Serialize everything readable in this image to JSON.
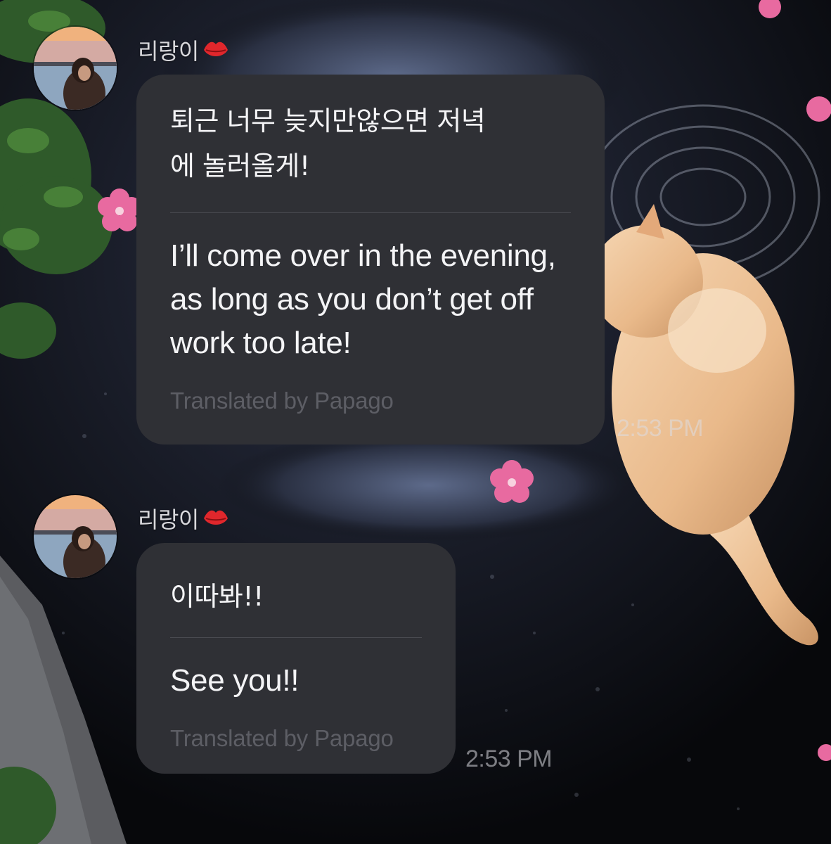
{
  "messages": [
    {
      "sender": "리랑이",
      "sender_icon": "kiss-lips-icon",
      "original": "퇴근 너무 늦지만않으면 저녁\n에 놀러올게!",
      "translation": "I’ll come over in the evening, as long as you don’t get off work too late!",
      "credit": "Translated by Papago",
      "time": "2:53 PM"
    },
    {
      "sender": "리랑이",
      "sender_icon": "kiss-lips-icon",
      "original": "이따봐!!",
      "translation": "See you!!",
      "credit": "Translated by Papago",
      "time": "2:53 PM"
    }
  ],
  "colors": {
    "bubble": "#2f3035",
    "lips": "#e0272c"
  }
}
